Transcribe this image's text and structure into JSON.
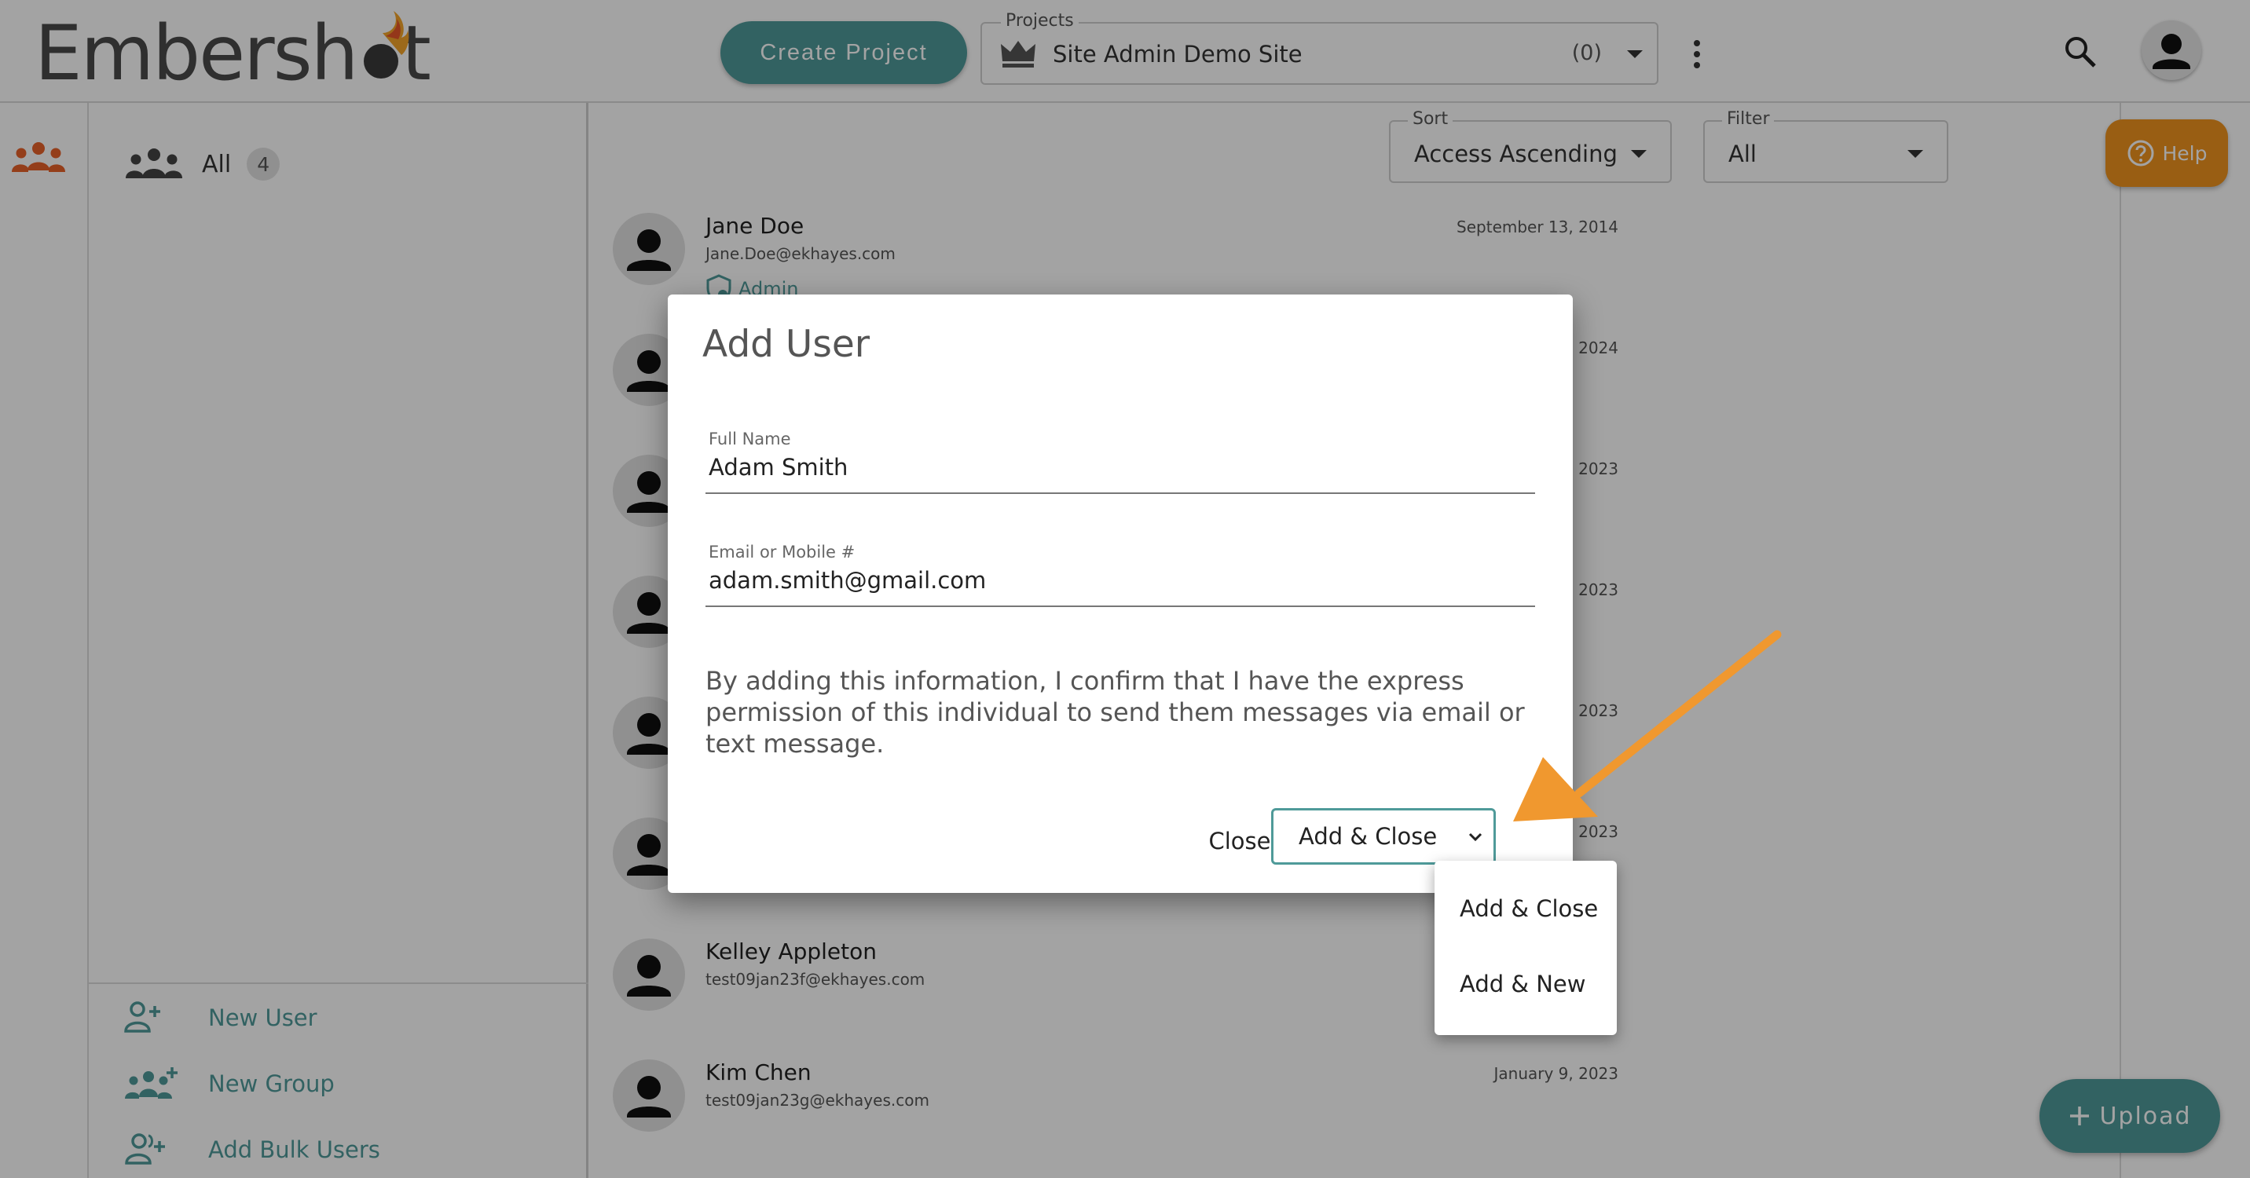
{
  "header": {
    "logo_text": "Embersh",
    "logo_tail": "t",
    "create_project_label": "Create Project",
    "projects_legend": "Projects",
    "project_name": "Site Admin Demo Site",
    "project_count": "(0)",
    "icons": [
      "crown-icon",
      "more-vert-icon",
      "search-icon",
      "account-icon"
    ]
  },
  "sidebar": {
    "all_label": "All",
    "all_count": "4",
    "actions": [
      {
        "label": "New User",
        "icon": "person-add-icon"
      },
      {
        "label": "New Group",
        "icon": "group-add-icon"
      },
      {
        "label": "Add Bulk Users",
        "icon": "bulk-add-icon"
      }
    ]
  },
  "toolbar": {
    "sort_legend": "Sort",
    "sort_value": "Access Ascending",
    "filter_legend": "Filter",
    "filter_value": "All",
    "help_label": "Help"
  },
  "users": [
    {
      "name": "Jane Doe",
      "email": "Jane.Doe@ekhayes.com",
      "date": "September 13, 2014",
      "role": "Admin"
    },
    {
      "name": "",
      "email": "",
      "date": "2024"
    },
    {
      "name": "",
      "email": "",
      "date": "2023"
    },
    {
      "name": "",
      "email": "",
      "date": "2023"
    },
    {
      "name": "",
      "email": "",
      "date": "2023"
    },
    {
      "name": "",
      "email": "",
      "date": "2023"
    },
    {
      "name": "Kelley Appleton",
      "email": "test09jan23f@ekhayes.com",
      "date": ""
    },
    {
      "name": "Kim Chen",
      "email": "test09jan23g@ekhayes.com",
      "date": "January 9, 2023"
    }
  ],
  "upload_label": "Upload",
  "dialog": {
    "title": "Add User",
    "full_name_label": "Full Name",
    "full_name_value": "Adam Smith",
    "contact_label": "Email or Mobile #",
    "contact_value": "adam.smith@gmail.com",
    "consent_text": "By adding this information, I confirm that I have the express permission of this individual to send them messages via email or text message.",
    "close_label": "Close",
    "primary_label": "Add & Close"
  },
  "menu": {
    "items": [
      "Add & Close",
      "Add & New"
    ]
  },
  "colors": {
    "teal": "#4f9a99",
    "orange": "#f0931e",
    "annotation_arrow": "#f0982f",
    "flame": "#e8792a"
  }
}
